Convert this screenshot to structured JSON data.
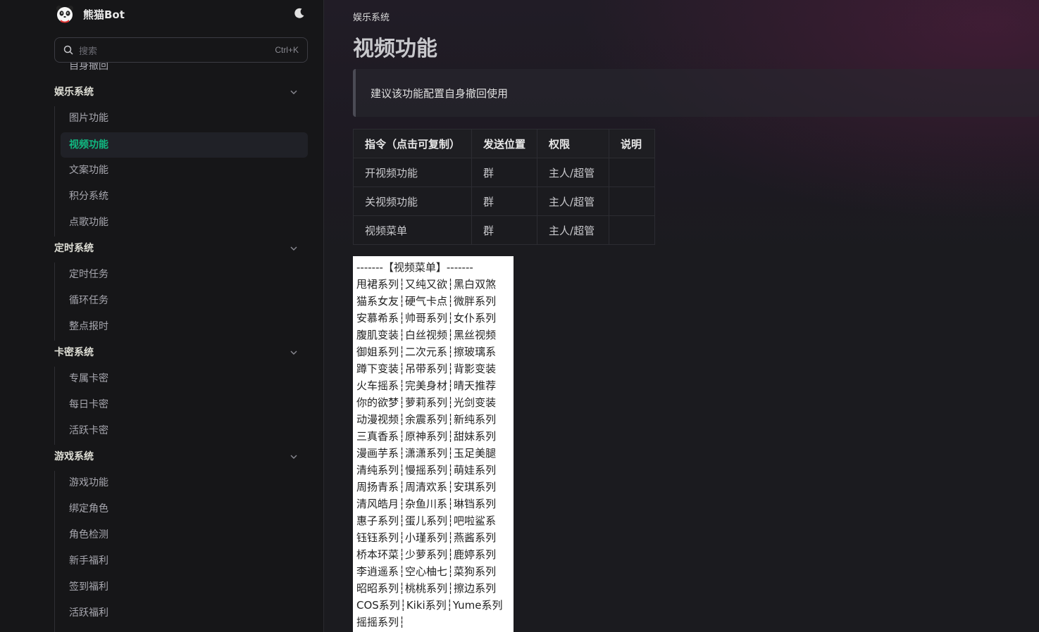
{
  "brand": {
    "name": "熊猫Bot",
    "logo_icon": "panda-icon",
    "theme_icon": "moon-icon"
  },
  "search": {
    "placeholder": "搜索",
    "shortcut": "Ctrl+K"
  },
  "sidebar": {
    "partial_item": "自身撤回",
    "groups": [
      {
        "title": "娱乐系统",
        "items": [
          "图片功能",
          "视频功能",
          "文案功能",
          "积分系统",
          "点歌功能"
        ]
      },
      {
        "title": "定时系统",
        "items": [
          "定时任务",
          "循环任务",
          "整点报时"
        ]
      },
      {
        "title": "卡密系统",
        "items": [
          "专属卡密",
          "每日卡密",
          "活跃卡密"
        ]
      },
      {
        "title": "游戏系统",
        "items": [
          "游戏功能",
          "绑定角色",
          "角色检测",
          "新手福利",
          "签到福利",
          "活跃福利"
        ]
      }
    ],
    "active_item": "视频功能"
  },
  "page": {
    "breadcrumb": "娱乐系统",
    "title": "视频功能",
    "tip": "建议该功能配置自身撤回使用"
  },
  "table": {
    "headers": [
      "指令（点击可复制）",
      "发送位置",
      "权限",
      "说明"
    ],
    "rows": [
      [
        "开视频功能",
        "群",
        "主人/超管",
        ""
      ],
      [
        "关视频功能",
        "群",
        "主人/超管",
        ""
      ],
      [
        "视频菜单",
        "群",
        "主人/超管",
        ""
      ]
    ]
  },
  "menu_image": {
    "lines": [
      "-------【视频菜单】-------",
      "甩裙系列┆又纯又欲┆黑白双煞",
      "猫系女友┆硬气卡点┆微胖系列",
      "安慕希系┆帅哥系列┆女仆系列",
      "腹肌变装┆白丝视频┆黑丝视频",
      "御姐系列┆二次元系┆擦玻璃系",
      "蹲下变装┆吊带系列┆背影变装",
      "火车摇系┆完美身材┆晴天推荐",
      "你的欲梦┆萝莉系列┆光剑变装",
      "动漫视频┆余震系列┆新纯系列",
      "三真香系┆原神系列┆甜妹系列",
      "漫画芋系┆潇潇系列┆玉足美腿",
      "清纯系列┆慢摇系列┆萌娃系列",
      "周扬青系┆周清欢系┆安琪系列",
      "清风皓月┆杂鱼川系┆琳铛系列",
      "惠子系列┆蛋儿系列┆吧啦鲨系",
      "钰钰系列┆小瑾系列┆燕酱系列",
      "桥本环菜┆少萝系列┆鹿婷系列",
      "李逍遥系┆空心柚七┆菜狗系列",
      "昭昭系列┆桃桃系列┆擦边系列",
      "COS系列┆Kiki系列┆Yume系列",
      "摇摇系列┆"
    ]
  },
  "colors": {
    "accent": "#10b981",
    "background": "#1b1b1f",
    "sidebar": "#161618"
  }
}
